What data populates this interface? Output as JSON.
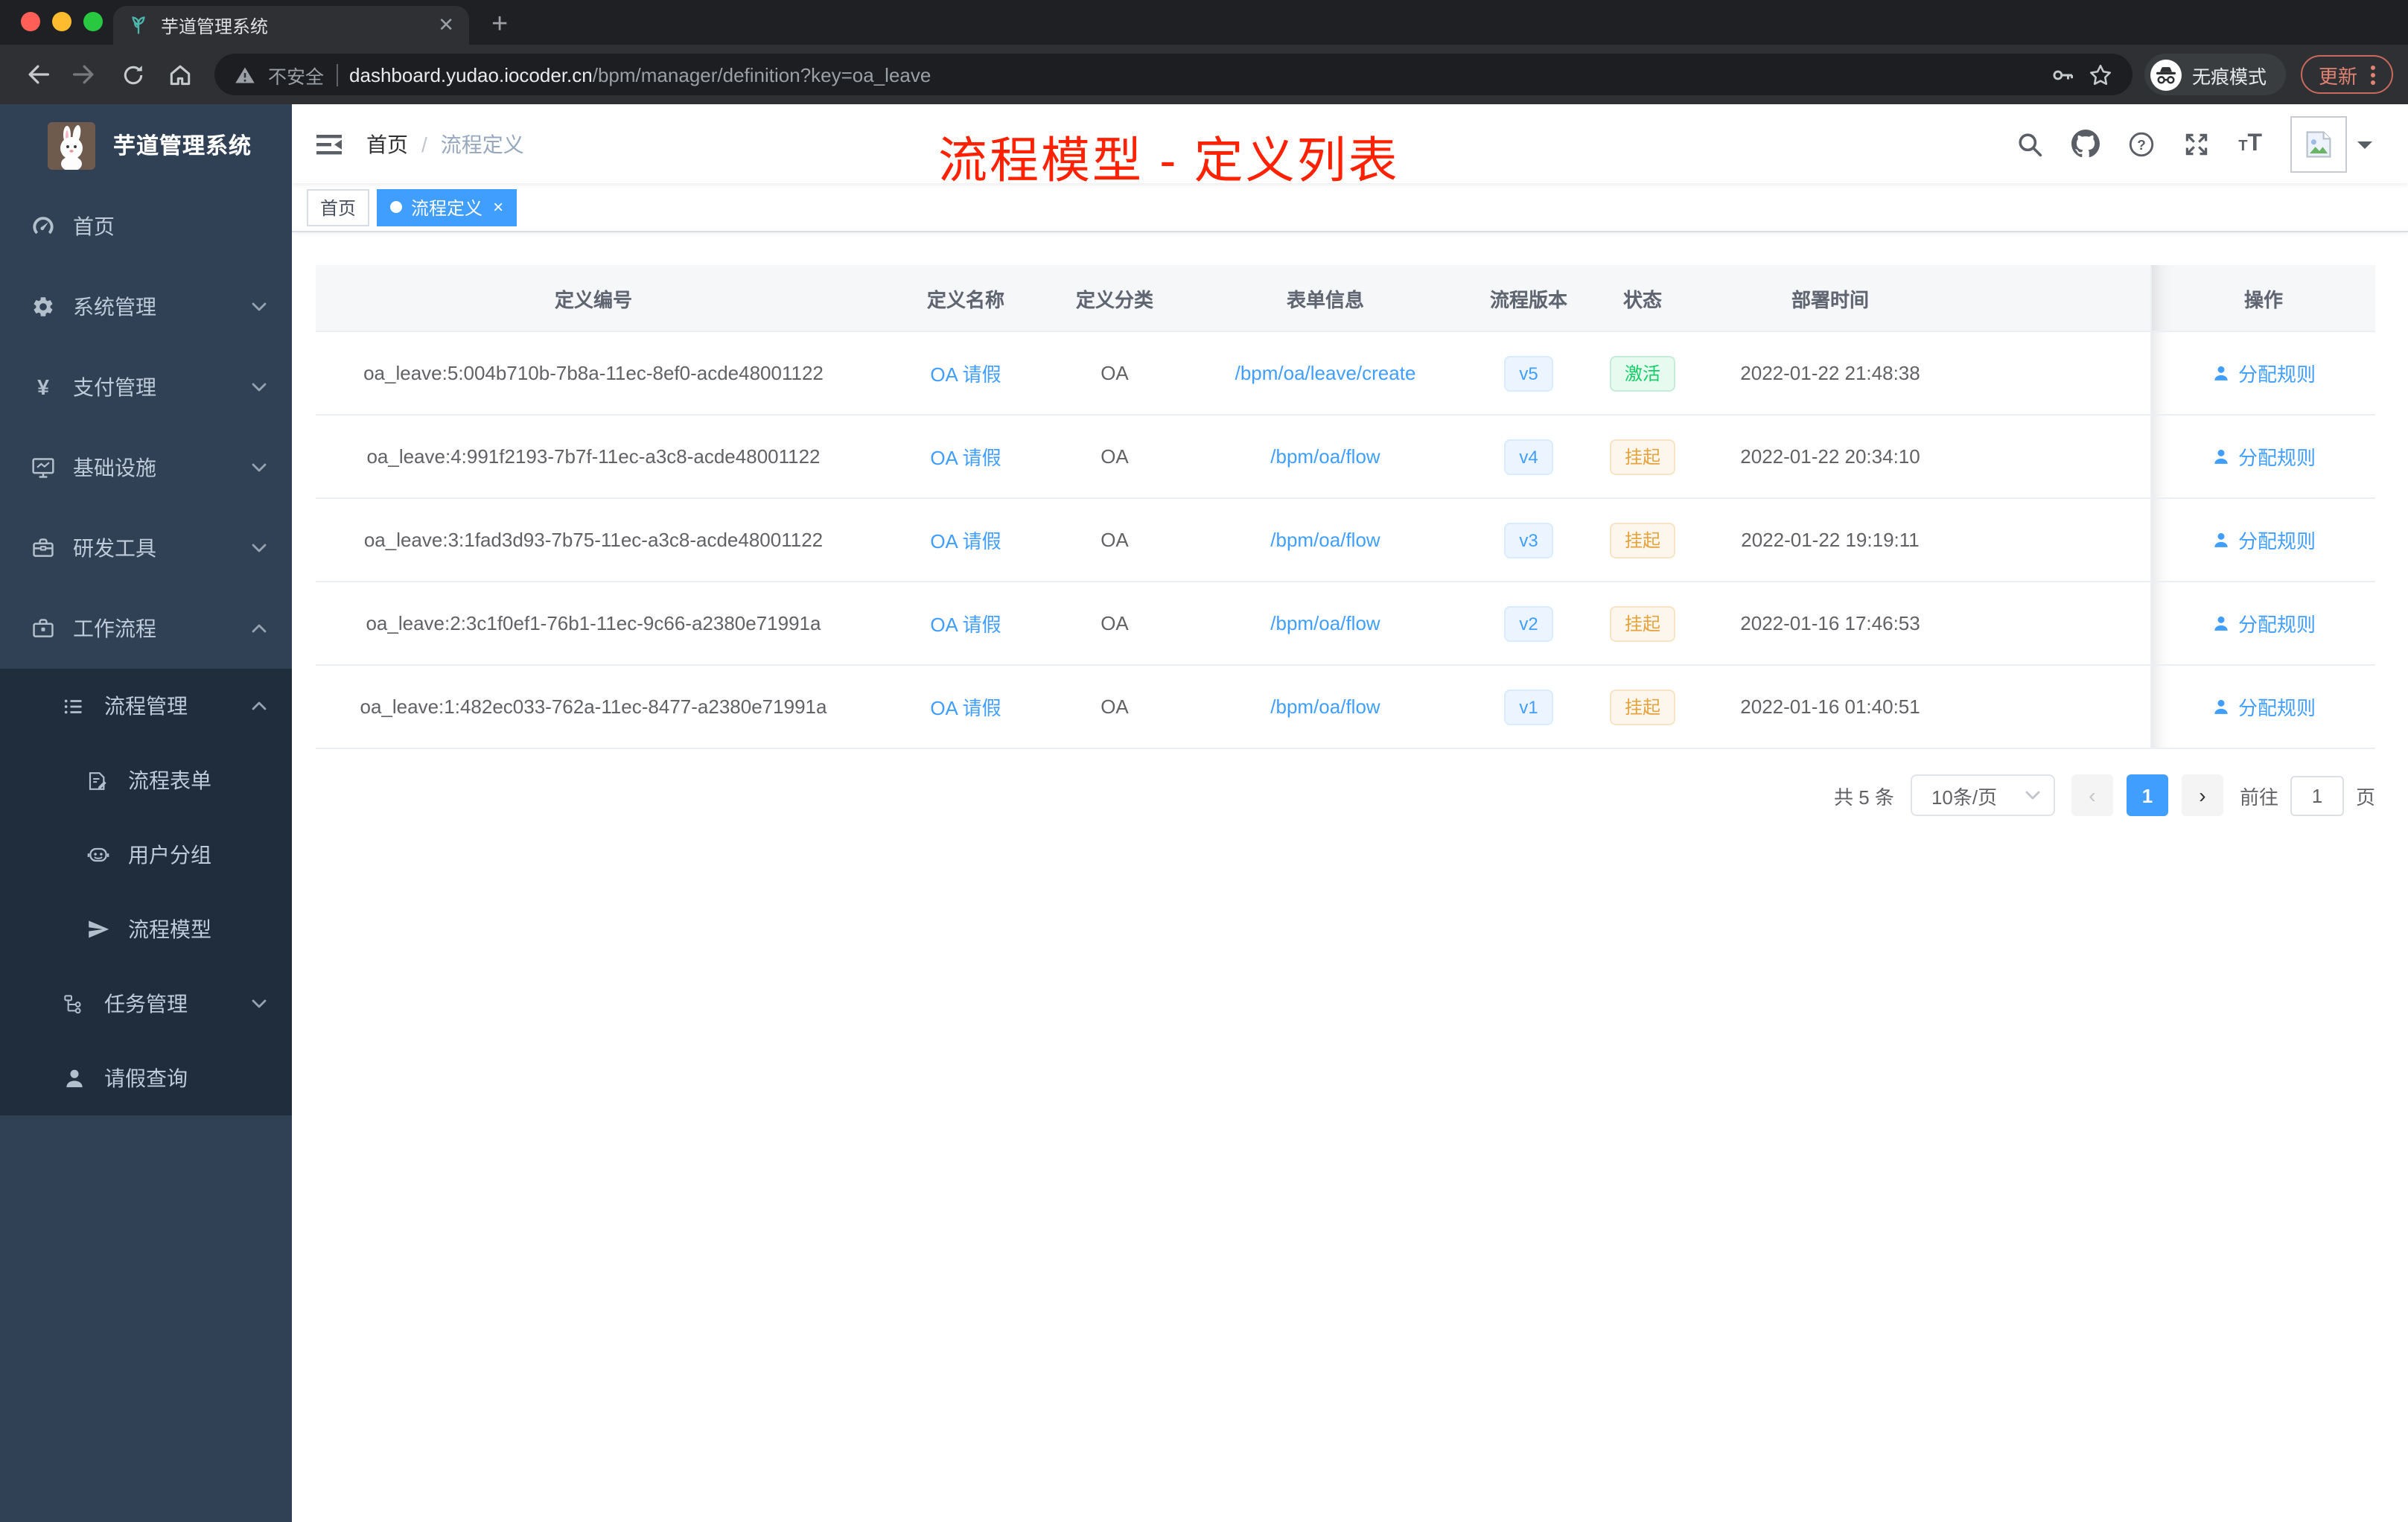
{
  "colors": {
    "accent": "#409eff",
    "annotation_red": "#ff2100",
    "sidebar_bg": "#304156",
    "submenu_bg": "#1f2d3d",
    "success_text": "#13ce66",
    "warning_text": "#e6a23c"
  },
  "browser": {
    "tab": {
      "title": "芋道管理系统",
      "close_glyph": "✕",
      "new_tab_glyph": "+"
    },
    "toolbar": {
      "security_label": "不安全",
      "url_domain": "dashboard.yudao.iocoder.cn",
      "url_path": "/bpm/manager/definition?key=oa_leave",
      "incognito_label": "无痕模式",
      "update_label": "更新"
    }
  },
  "sidebar": {
    "logo_title": "芋道管理系统",
    "items": [
      {
        "key": "home",
        "label": "首页",
        "icon": "dashboard-icon",
        "level": 1
      },
      {
        "key": "system-management",
        "label": "系统管理",
        "icon": "gear-icon",
        "level": 1,
        "chevron": "down"
      },
      {
        "key": "payment-management",
        "label": "支付管理",
        "icon": "yen-icon",
        "level": 1,
        "chevron": "down"
      },
      {
        "key": "infrastructure",
        "label": "基础设施",
        "icon": "monitor-icon",
        "level": 1,
        "chevron": "down"
      },
      {
        "key": "dev-tools",
        "label": "研发工具",
        "icon": "toolbox-icon",
        "level": 1,
        "chevron": "down"
      },
      {
        "key": "workflow",
        "label": "工作流程",
        "icon": "briefcase-icon",
        "level": 1,
        "chevron": "up"
      },
      {
        "key": "process-management",
        "label": "流程管理",
        "icon": "list-icon",
        "level": 2,
        "chevron": "up",
        "dark": true
      },
      {
        "key": "process-form",
        "label": "流程表单",
        "icon": "form-icon",
        "level": 3,
        "dark": true
      },
      {
        "key": "user-group",
        "label": "用户分组",
        "icon": "robot-icon",
        "level": 3,
        "dark": true
      },
      {
        "key": "process-model",
        "label": "流程模型",
        "icon": "paper-plane-icon",
        "level": 3,
        "dark": true
      },
      {
        "key": "task-management",
        "label": "任务管理",
        "icon": "tree-icon",
        "level": 2,
        "chevron": "down",
        "dark": true
      },
      {
        "key": "leave-query",
        "label": "请假查询",
        "icon": "user-icon",
        "level": 2,
        "dark": true
      }
    ]
  },
  "navbar": {
    "breadcrumb": [
      "首页",
      "流程定义"
    ]
  },
  "tags": [
    {
      "label": "首页",
      "active": false
    },
    {
      "label": "流程定义",
      "active": true
    }
  ],
  "annotation": "流程模型 - 定义列表",
  "table": {
    "headers": [
      "定义编号",
      "定义名称",
      "定义分类",
      "表单信息",
      "流程版本",
      "状态",
      "部署时间",
      "操作"
    ],
    "rows": [
      {
        "id": "oa_leave:5:004b710b-7b8a-11ec-8ef0-acde48001122",
        "name": "OA 请假",
        "category": "OA",
        "form": "/bpm/oa/leave/create",
        "version": "v5",
        "status": "激活",
        "status_type": "success",
        "time": "2022-01-22 21:48:38",
        "action": "分配规则"
      },
      {
        "id": "oa_leave:4:991f2193-7b7f-11ec-a3c8-acde48001122",
        "name": "OA 请假",
        "category": "OA",
        "form": "/bpm/oa/flow",
        "version": "v4",
        "status": "挂起",
        "status_type": "warning",
        "time": "2022-01-22 20:34:10",
        "action": "分配规则"
      },
      {
        "id": "oa_leave:3:1fad3d93-7b75-11ec-a3c8-acde48001122",
        "name": "OA 请假",
        "category": "OA",
        "form": "/bpm/oa/flow",
        "version": "v3",
        "status": "挂起",
        "status_type": "warning",
        "time": "2022-01-22 19:19:11",
        "action": "分配规则"
      },
      {
        "id": "oa_leave:2:3c1f0ef1-76b1-11ec-9c66-a2380e71991a",
        "name": "OA 请假",
        "category": "OA",
        "form": "/bpm/oa/flow",
        "version": "v2",
        "status": "挂起",
        "status_type": "warning",
        "time": "2022-01-16 17:46:53",
        "action": "分配规则"
      },
      {
        "id": "oa_leave:1:482ec033-762a-11ec-8477-a2380e71991a",
        "name": "OA 请假",
        "category": "OA",
        "form": "/bpm/oa/flow",
        "version": "v1",
        "status": "挂起",
        "status_type": "warning",
        "time": "2022-01-16 01:40:51",
        "action": "分配规则"
      }
    ]
  },
  "pagination": {
    "total_label": "共 5 条",
    "page_size": "10条/页",
    "current_page": "1",
    "goto_label": "前往",
    "goto_value": "1",
    "page_suffix": "页"
  }
}
